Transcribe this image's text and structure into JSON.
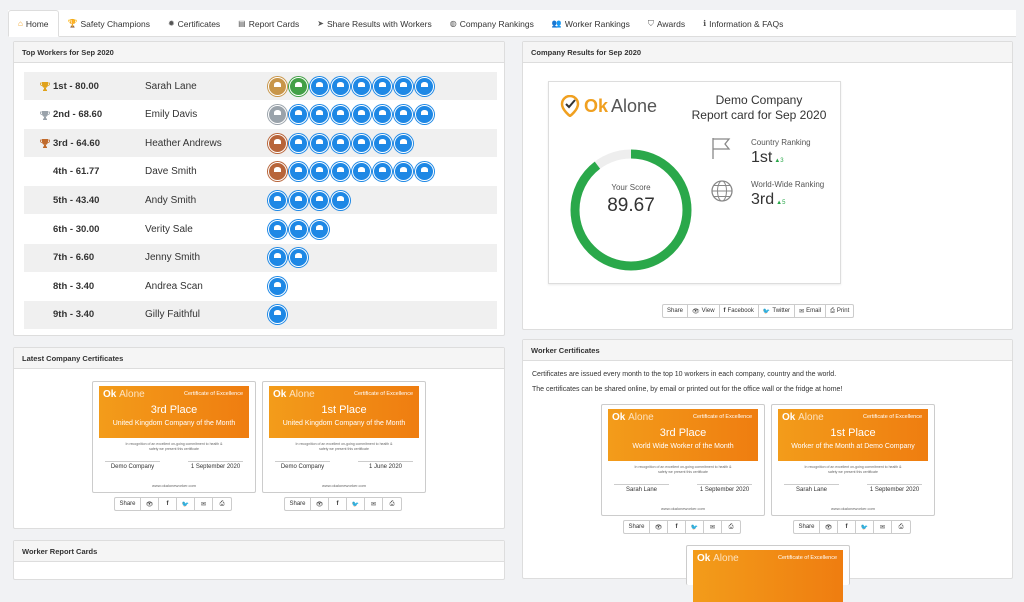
{
  "tabs": [
    {
      "icon": "home-icon",
      "glyph": "⌂",
      "label": "Home",
      "active": true
    },
    {
      "icon": "trophy-icon",
      "glyph": "🏆",
      "label": "Safety Champions"
    },
    {
      "icon": "certificate-icon",
      "glyph": "✹",
      "label": "Certificates"
    },
    {
      "icon": "document-icon",
      "glyph": "▤",
      "label": "Report Cards"
    },
    {
      "icon": "send-icon",
      "glyph": "➤",
      "label": "Share Results with Workers"
    },
    {
      "icon": "globe-icon",
      "glyph": "◍",
      "label": "Company Rankings"
    },
    {
      "icon": "users-icon",
      "glyph": "👥",
      "label": "Worker Rankings"
    },
    {
      "icon": "shield-icon",
      "glyph": "⛉",
      "label": "Awards"
    },
    {
      "icon": "info-icon",
      "glyph": "ℹ",
      "label": "Information & FAQs"
    }
  ],
  "top_workers": {
    "title": "Top Workers for Sep 2020",
    "rows": [
      {
        "rank": "1st - 80.00",
        "name": "Sarah Lane",
        "cup": "gold",
        "badges": [
          "gold",
          "green",
          "b",
          "b",
          "b",
          "b",
          "b",
          "b"
        ]
      },
      {
        "rank": "2nd - 68.60",
        "name": "Emily Davis",
        "cup": "silver",
        "badges": [
          "silver",
          "b",
          "b",
          "b",
          "b",
          "b",
          "b",
          "b"
        ]
      },
      {
        "rank": "3rd - 64.60",
        "name": "Heather Andrews",
        "cup": "bronze",
        "badges": [
          "bronze",
          "b",
          "b",
          "b",
          "b",
          "b",
          "b"
        ]
      },
      {
        "rank": "4th - 61.77",
        "name": "Dave Smith",
        "cup": "",
        "badges": [
          "bronze",
          "b",
          "b",
          "b",
          "b",
          "b",
          "b",
          "b"
        ]
      },
      {
        "rank": "5th - 43.40",
        "name": "Andy Smith",
        "cup": "",
        "badges": [
          "b",
          "b",
          "b",
          "b"
        ]
      },
      {
        "rank": "6th - 30.00",
        "name": "Verity Sale",
        "cup": "",
        "badges": [
          "b",
          "b",
          "b"
        ]
      },
      {
        "rank": "7th - 6.60",
        "name": "Jenny Smith",
        "cup": "",
        "badges": [
          "b",
          "b"
        ]
      },
      {
        "rank": "8th - 3.40",
        "name": "Andrea Scan",
        "cup": "",
        "badges": [
          "b"
        ]
      },
      {
        "rank": "9th - 3.40",
        "name": "Gilly Faithful",
        "cup": "",
        "badges": [
          "b"
        ]
      }
    ]
  },
  "company_results": {
    "title": "Company Results for Sep 2020",
    "logo_ok": "Ok",
    "logo_alone": "Alone",
    "company": "Demo Company",
    "report": "Report card for Sep 2020",
    "score_label": "Your Score",
    "score": "89.67",
    "score_pct": 0.8967,
    "country_label": "Country Ranking",
    "country_rank": "1st",
    "country_delta": "▲3",
    "world_label": "World-Wide Ranking",
    "world_rank": "3rd",
    "world_delta": "▲5",
    "share": {
      "share": "Share",
      "view": "View",
      "facebook": "Facebook",
      "twitter": "Twitter",
      "email": "Email",
      "print": "Print"
    }
  },
  "latest_certs": {
    "title": "Latest Company Certificates",
    "certs": [
      {
        "place": "3rd Place",
        "sub": "United Kingdom Company of the Month",
        "name": "Demo Company",
        "date": "1 September 2020"
      },
      {
        "place": "1st Place",
        "sub": "United Kingdom Company of the Month",
        "name": "Demo Company",
        "date": "1 June 2020"
      }
    ]
  },
  "worker_certs": {
    "title": "Worker Certificates",
    "line1": "Certificates are issued every month to the top 10 workers in each company, country and the world.",
    "line2": "The certificates can be shared online, by email or printed out for the office wall or the fridge at home!",
    "certs": [
      {
        "place": "3rd Place",
        "sub": "World Wide Worker of the Month",
        "name": "Sarah Lane",
        "date": "1 September 2020"
      },
      {
        "place": "1st Place",
        "sub": "Worker of the Month at Demo Company",
        "name": "Sarah Lane",
        "date": "1 September 2020"
      }
    ]
  },
  "cert_common": {
    "logo_ok": "Ok",
    "logo_alone": "Alone",
    "coe": "Certificate of Excellence",
    "recog": "In recognition of an excellent on-going commitment to health & safety we present this certificate",
    "url": "www.okaloneworker.com",
    "share": "Share"
  },
  "worker_report_cards": {
    "title": "Worker Report Cards"
  },
  "colors": {
    "accent": "#f0a020",
    "score_green": "#2aa84a",
    "badge_blue": "#1e88e5",
    "cert_orange": "#ef7d10"
  }
}
